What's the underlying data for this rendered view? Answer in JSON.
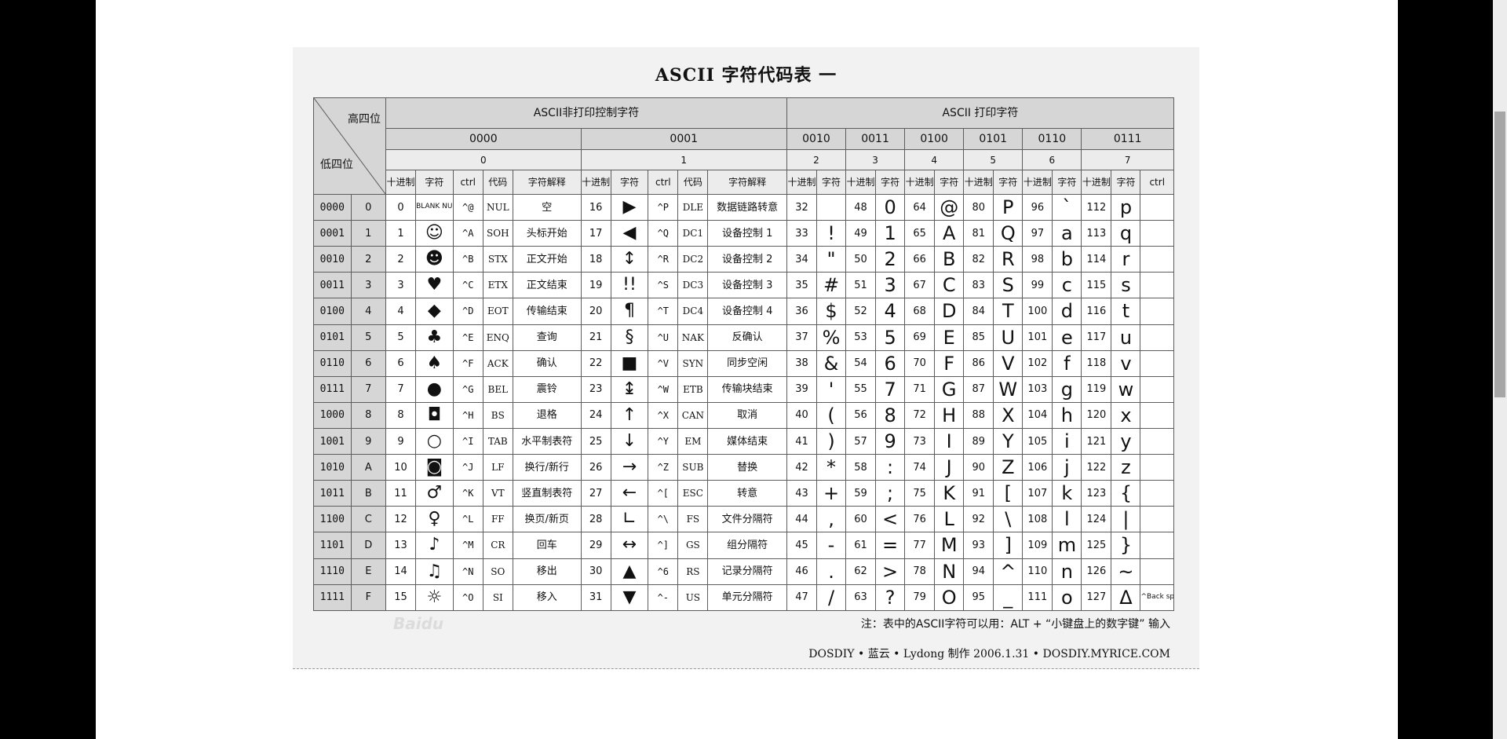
{
  "title": "ASCII 字符代码表 一",
  "corner": {
    "high": "高四位",
    "low": "低四位"
  },
  "groups": {
    "ctrl": "ASCII非打印控制字符",
    "print": "ASCII 打印字符"
  },
  "col_labels": {
    "dec": "十进制",
    "char": "字符",
    "ctrl": "ctrl",
    "code": "代码",
    "desc": "字符解释"
  },
  "high_bits": [
    {
      "bin": "0000",
      "hex": "0"
    },
    {
      "bin": "0001",
      "hex": "1"
    },
    {
      "bin": "0010",
      "hex": "2"
    },
    {
      "bin": "0011",
      "hex": "3"
    },
    {
      "bin": "0100",
      "hex": "4"
    },
    {
      "bin": "0101",
      "hex": "5"
    },
    {
      "bin": "0110",
      "hex": "6"
    },
    {
      "bin": "0111",
      "hex": "7"
    }
  ],
  "rows": [
    {
      "bin": "0000",
      "hex": "0",
      "c0": {
        "dec": "0",
        "ch": "BLANK NULL",
        "ctrl": "^@",
        "code": "NUL",
        "desc": "空"
      },
      "c1": {
        "dec": "16",
        "ch": "▶",
        "ctrl": "^P",
        "code": "DLE",
        "desc": "数据链路转意"
      },
      "p": [
        [
          "32",
          ""
        ],
        [
          "48",
          "0"
        ],
        [
          "64",
          "@"
        ],
        [
          "80",
          "P"
        ],
        [
          "96",
          "`"
        ],
        [
          "112",
          "p"
        ]
      ]
    },
    {
      "bin": "0001",
      "hex": "1",
      "c0": {
        "dec": "1",
        "ch": "☺",
        "ctrl": "^A",
        "code": "SOH",
        "desc": "头标开始"
      },
      "c1": {
        "dec": "17",
        "ch": "◀",
        "ctrl": "^Q",
        "code": "DC1",
        "desc": "设备控制 1"
      },
      "p": [
        [
          "33",
          "!"
        ],
        [
          "49",
          "1"
        ],
        [
          "65",
          "A"
        ],
        [
          "81",
          "Q"
        ],
        [
          "97",
          "a"
        ],
        [
          "113",
          "q"
        ]
      ]
    },
    {
      "bin": "0010",
      "hex": "2",
      "c0": {
        "dec": "2",
        "ch": "☻",
        "ctrl": "^B",
        "code": "STX",
        "desc": "正文开始"
      },
      "c1": {
        "dec": "18",
        "ch": "↕",
        "ctrl": "^R",
        "code": "DC2",
        "desc": "设备控制 2"
      },
      "p": [
        [
          "34",
          "\""
        ],
        [
          "50",
          "2"
        ],
        [
          "66",
          "B"
        ],
        [
          "82",
          "R"
        ],
        [
          "98",
          "b"
        ],
        [
          "114",
          "r"
        ]
      ]
    },
    {
      "bin": "0011",
      "hex": "3",
      "c0": {
        "dec": "3",
        "ch": "♥",
        "ctrl": "^C",
        "code": "ETX",
        "desc": "正文结束"
      },
      "c1": {
        "dec": "19",
        "ch": "!!",
        "ctrl": "^S",
        "code": "DC3",
        "desc": "设备控制 3"
      },
      "p": [
        [
          "35",
          "#"
        ],
        [
          "51",
          "3"
        ],
        [
          "67",
          "C"
        ],
        [
          "83",
          "S"
        ],
        [
          "99",
          "c"
        ],
        [
          "115",
          "s"
        ]
      ]
    },
    {
      "bin": "0100",
      "hex": "4",
      "c0": {
        "dec": "4",
        "ch": "◆",
        "ctrl": "^D",
        "code": "EOT",
        "desc": "传输结束"
      },
      "c1": {
        "dec": "20",
        "ch": "¶",
        "ctrl": "^T",
        "code": "DC4",
        "desc": "设备控制 4"
      },
      "p": [
        [
          "36",
          "$"
        ],
        [
          "52",
          "4"
        ],
        [
          "68",
          "D"
        ],
        [
          "84",
          "T"
        ],
        [
          "100",
          "d"
        ],
        [
          "116",
          "t"
        ]
      ]
    },
    {
      "bin": "0101",
      "hex": "5",
      "c0": {
        "dec": "5",
        "ch": "♣",
        "ctrl": "^E",
        "code": "ENQ",
        "desc": "查询"
      },
      "c1": {
        "dec": "21",
        "ch": "§",
        "ctrl": "^U",
        "code": "NAK",
        "desc": "反确认"
      },
      "p": [
        [
          "37",
          "%"
        ],
        [
          "53",
          "5"
        ],
        [
          "69",
          "E"
        ],
        [
          "85",
          "U"
        ],
        [
          "101",
          "e"
        ],
        [
          "117",
          "u"
        ]
      ]
    },
    {
      "bin": "0110",
      "hex": "6",
      "c0": {
        "dec": "6",
        "ch": "♠",
        "ctrl": "^F",
        "code": "ACK",
        "desc": "确认"
      },
      "c1": {
        "dec": "22",
        "ch": "■",
        "ctrl": "^V",
        "code": "SYN",
        "desc": "同步空闲"
      },
      "p": [
        [
          "38",
          "&"
        ],
        [
          "54",
          "6"
        ],
        [
          "70",
          "F"
        ],
        [
          "86",
          "V"
        ],
        [
          "102",
          "f"
        ],
        [
          "118",
          "v"
        ]
      ]
    },
    {
      "bin": "0111",
      "hex": "7",
      "c0": {
        "dec": "7",
        "ch": "●",
        "ctrl": "^G",
        "code": "BEL",
        "desc": "震铃"
      },
      "c1": {
        "dec": "23",
        "ch": "↨",
        "ctrl": "^W",
        "code": "ETB",
        "desc": "传输块结束"
      },
      "p": [
        [
          "39",
          "'"
        ],
        [
          "55",
          "7"
        ],
        [
          "71",
          "G"
        ],
        [
          "87",
          "W"
        ],
        [
          "103",
          "g"
        ],
        [
          "119",
          "w"
        ]
      ]
    },
    {
      "bin": "1000",
      "hex": "8",
      "c0": {
        "dec": "8",
        "ch": "◘",
        "ctrl": "^H",
        "code": "BS",
        "desc": "退格"
      },
      "c1": {
        "dec": "24",
        "ch": "↑",
        "ctrl": "^X",
        "code": "CAN",
        "desc": "取消"
      },
      "p": [
        [
          "40",
          "("
        ],
        [
          "56",
          "8"
        ],
        [
          "72",
          "H"
        ],
        [
          "88",
          "X"
        ],
        [
          "104",
          "h"
        ],
        [
          "120",
          "x"
        ]
      ]
    },
    {
      "bin": "1001",
      "hex": "9",
      "c0": {
        "dec": "9",
        "ch": "○",
        "ctrl": "^I",
        "code": "TAB",
        "desc": "水平制表符"
      },
      "c1": {
        "dec": "25",
        "ch": "↓",
        "ctrl": "^Y",
        "code": "EM",
        "desc": "媒体结束"
      },
      "p": [
        [
          "41",
          ")"
        ],
        [
          "57",
          "9"
        ],
        [
          "73",
          "I"
        ],
        [
          "89",
          "Y"
        ],
        [
          "105",
          "i"
        ],
        [
          "121",
          "y"
        ]
      ]
    },
    {
      "bin": "1010",
      "hex": "A",
      "c0": {
        "dec": "10",
        "ch": "◙",
        "ctrl": "^J",
        "code": "LF",
        "desc": "换行/新行"
      },
      "c1": {
        "dec": "26",
        "ch": "→",
        "ctrl": "^Z",
        "code": "SUB",
        "desc": "替换"
      },
      "p": [
        [
          "42",
          "*"
        ],
        [
          "58",
          ":"
        ],
        [
          "74",
          "J"
        ],
        [
          "90",
          "Z"
        ],
        [
          "106",
          "j"
        ],
        [
          "122",
          "z"
        ]
      ]
    },
    {
      "bin": "1011",
      "hex": "B",
      "c0": {
        "dec": "11",
        "ch": "♂",
        "ctrl": "^K",
        "code": "VT",
        "desc": "竖直制表符"
      },
      "c1": {
        "dec": "27",
        "ch": "←",
        "ctrl": "^[",
        "code": "ESC",
        "desc": "转意"
      },
      "p": [
        [
          "43",
          "+"
        ],
        [
          "59",
          ";"
        ],
        [
          "75",
          "K"
        ],
        [
          "91",
          "["
        ],
        [
          "107",
          "k"
        ],
        [
          "123",
          "{"
        ]
      ]
    },
    {
      "bin": "1100",
      "hex": "C",
      "c0": {
        "dec": "12",
        "ch": "♀",
        "ctrl": "^L",
        "code": "FF",
        "desc": "换页/新页"
      },
      "c1": {
        "dec": "28",
        "ch": "∟",
        "ctrl": "^\\",
        "code": "FS",
        "desc": "文件分隔符"
      },
      "p": [
        [
          "44",
          ","
        ],
        [
          "60",
          "<"
        ],
        [
          "76",
          "L"
        ],
        [
          "92",
          "\\"
        ],
        [
          "108",
          "l"
        ],
        [
          "124",
          "|"
        ]
      ]
    },
    {
      "bin": "1101",
      "hex": "D",
      "c0": {
        "dec": "13",
        "ch": "♪",
        "ctrl": "^M",
        "code": "CR",
        "desc": "回车"
      },
      "c1": {
        "dec": "29",
        "ch": "↔",
        "ctrl": "^]",
        "code": "GS",
        "desc": "组分隔符"
      },
      "p": [
        [
          "45",
          "-"
        ],
        [
          "61",
          "="
        ],
        [
          "77",
          "M"
        ],
        [
          "93",
          "]"
        ],
        [
          "109",
          "m"
        ],
        [
          "125",
          "}"
        ]
      ]
    },
    {
      "bin": "1110",
      "hex": "E",
      "c0": {
        "dec": "14",
        "ch": "♫",
        "ctrl": "^N",
        "code": "SO",
        "desc": "移出"
      },
      "c1": {
        "dec": "30",
        "ch": "▲",
        "ctrl": "^6",
        "code": "RS",
        "desc": "记录分隔符"
      },
      "p": [
        [
          "46",
          "."
        ],
        [
          "62",
          ">"
        ],
        [
          "78",
          "N"
        ],
        [
          "94",
          "^"
        ],
        [
          "110",
          "n"
        ],
        [
          "126",
          "~"
        ]
      ]
    },
    {
      "bin": "1111",
      "hex": "F",
      "c0": {
        "dec": "15",
        "ch": "☼",
        "ctrl": "^O",
        "code": "SI",
        "desc": "移入"
      },
      "c1": {
        "dec": "31",
        "ch": "▼",
        "ctrl": "^-",
        "code": "US",
        "desc": "单元分隔符"
      },
      "p": [
        [
          "47",
          "/"
        ],
        [
          "63",
          "?"
        ],
        [
          "79",
          "O"
        ],
        [
          "95",
          "_"
        ],
        [
          "111",
          "o"
        ],
        [
          "127",
          "Δ"
        ]
      ],
      "last_ctrl": "^Back space"
    }
  ],
  "note": "注：表中的ASCII字符可以用：ALT + “小键盘上的数字键” 输入",
  "credit": "DOSDIY • 蓝云 • Lydong 制作 2006.1.31 • DOSDIY.MYRICE.COM",
  "watermark": "Baidu"
}
